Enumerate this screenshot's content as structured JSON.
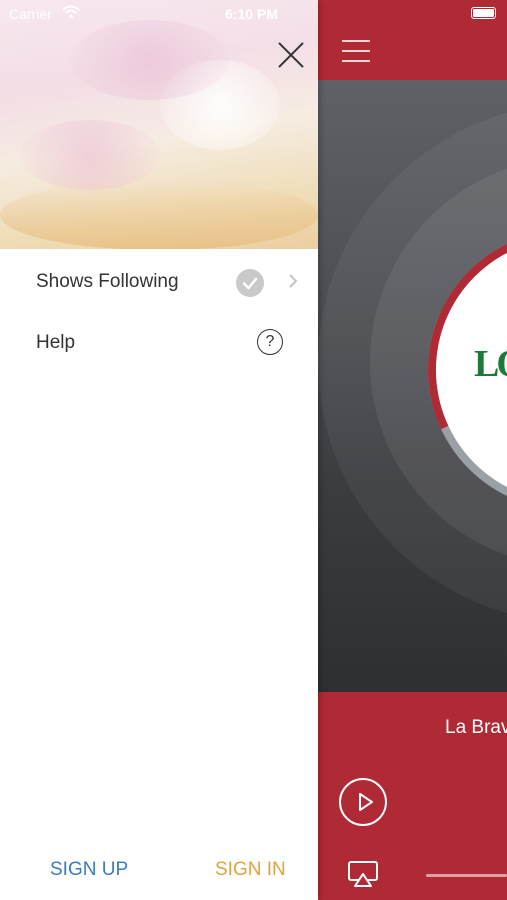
{
  "status_bar": {
    "carrier": "Carrier",
    "time": "6:10 PM"
  },
  "drawer": {
    "menu": [
      {
        "label": "Shows Following",
        "icon": "check-circle-icon"
      },
      {
        "label": "Help",
        "icon": "question-circle-icon"
      }
    ],
    "help_icon_glyph": "?",
    "sign_up_label": "SIGN UP",
    "sign_in_label": "SIGN IN"
  },
  "player": {
    "now_playing": "La Brav",
    "station_logo_text": "LO",
    "icons": [
      "hamburger-icon",
      "battery-icon",
      "play-icon",
      "airplay-icon"
    ]
  },
  "colors": {
    "brand_red": "#b02a36",
    "sign_up": "#3a7cc2",
    "sign_in": "#e1a23a",
    "logo_green": "#1e7a3a"
  }
}
